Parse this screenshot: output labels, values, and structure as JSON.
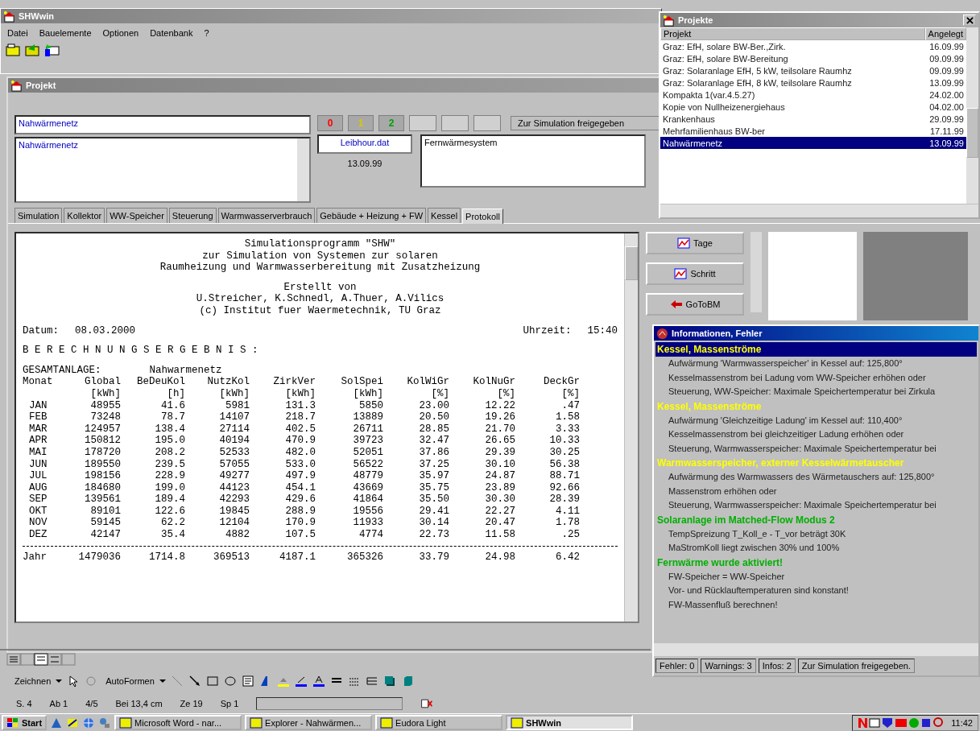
{
  "main_window": {
    "title": "SHWwin",
    "menu": [
      "Datei",
      "Bauelemente",
      "Optionen",
      "Datenbank",
      "?"
    ]
  },
  "project_window": {
    "title": "Projekt",
    "name_field": "Nahwärmenetz",
    "description_field": "Nahwärmenetz",
    "weather_file": "Leibhour.dat",
    "date": "13.09.99",
    "system_field": "Fernwärmesystem",
    "counters": [
      {
        "value": "0",
        "color": "#ff0000"
      },
      {
        "value": "1",
        "color": "#d8c800"
      },
      {
        "value": "2",
        "color": "#00a000"
      }
    ],
    "release_status": "Zur Simulation freigegeben",
    "tabs": [
      {
        "label": "Simulation",
        "selected": false
      },
      {
        "label": "Kollektor",
        "selected": false
      },
      {
        "label": "WW-Speicher",
        "selected": false
      },
      {
        "label": "Steuerung",
        "selected": false
      },
      {
        "label": "Warmwasserverbrauch",
        "selected": false
      },
      {
        "label": "Gebäude + Heizung + FW",
        "selected": false
      },
      {
        "label": "Kessel",
        "selected": false
      },
      {
        "label": "Protokoll",
        "selected": true
      }
    ],
    "report": {
      "title_lines": [
        "Simulationsprogramm \"SHW\"",
        "zur Simulation von Systemen zur solaren",
        "Raumheizung und Warmwasserbereitung mit Zusatzheizung"
      ],
      "credit_lines": [
        "Erstellt von",
        "U.Streicher, K.Schnedl, A.Thuer, A.Vilics",
        "(c) Institut fuer Waermetechnik, TU Graz"
      ],
      "date_label": "Datum:",
      "date": "08.03.2000",
      "time_label": "Uhrzeit:",
      "time": "15:40",
      "heading": "B E R E C H N U N G S E R G E B N I S :",
      "group_label": "GESAMTANLAGE:",
      "subsystem": "Nahwarmenetz",
      "columns": [
        {
          "name": "Monat"
        },
        {
          "name": "Global",
          "unit": "[kWh]"
        },
        {
          "name": "BeDeuKol",
          "unit": "[h]"
        },
        {
          "name": "NutzKol",
          "unit": "[kWh]"
        },
        {
          "name": "ZirkVer",
          "unit": "[kWh]"
        },
        {
          "name": "SolSpei",
          "unit": "[kWh]"
        },
        {
          "name": "KolWiGr",
          "unit": "[%]"
        },
        {
          "name": "KolNuGr",
          "unit": "[%]"
        },
        {
          "name": "DeckGr",
          "unit": "[%]"
        }
      ],
      "rows": [
        [
          "JAN",
          "48955",
          "41.6",
          "5981",
          "131.3",
          "5850",
          "23.00",
          "12.22",
          ".47"
        ],
        [
          "FEB",
          "73248",
          "78.7",
          "14107",
          "218.7",
          "13889",
          "20.50",
          "19.26",
          "1.58"
        ],
        [
          "MAR",
          "124957",
          "138.4",
          "27114",
          "402.5",
          "26711",
          "28.85",
          "21.70",
          "3.33"
        ],
        [
          "APR",
          "150812",
          "195.0",
          "40194",
          "470.9",
          "39723",
          "32.47",
          "26.65",
          "10.33"
        ],
        [
          "MAI",
          "178720",
          "208.2",
          "52533",
          "482.0",
          "52051",
          "37.86",
          "29.39",
          "30.25"
        ],
        [
          "JUN",
          "189550",
          "239.5",
          "57055",
          "533.0",
          "56522",
          "37.25",
          "30.10",
          "56.38"
        ],
        [
          "JUL",
          "198156",
          "228.9",
          "49277",
          "497.9",
          "48779",
          "35.97",
          "24.87",
          "88.71"
        ],
        [
          "AUG",
          "184680",
          "199.0",
          "44123",
          "454.1",
          "43669",
          "35.75",
          "23.89",
          "92.66"
        ],
        [
          "SEP",
          "139561",
          "189.4",
          "42293",
          "429.6",
          "41864",
          "35.50",
          "30.30",
          "28.39"
        ],
        [
          "OKT",
          "89101",
          "122.6",
          "19845",
          "288.9",
          "19556",
          "29.41",
          "22.27",
          "4.11"
        ],
        [
          "NOV",
          "59145",
          "62.2",
          "12104",
          "170.9",
          "11933",
          "30.14",
          "20.47",
          "1.78"
        ],
        [
          "DEZ",
          "42147",
          "35.4",
          "4882",
          "107.5",
          "4774",
          "22.73",
          "11.58",
          ".25"
        ]
      ],
      "total": [
        "Jahr",
        "1479036",
        "1714.8",
        "369513",
        "4187.1",
        "365326",
        "33.79",
        "24.98",
        "6.42"
      ]
    },
    "side_buttons": [
      "Tage",
      "Schritt",
      "GoToBM"
    ]
  },
  "projects_window": {
    "title": "Projekte",
    "columns": [
      "Projekt",
      "Angelegt"
    ],
    "rows": [
      {
        "name": "Graz: EfH, solare BW-Ber.,Zirk.",
        "date": "16.09.99",
        "selected": false
      },
      {
        "name": "Graz: EfH, solare BW-Bereitung",
        "date": "09.09.99",
        "selected": false
      },
      {
        "name": "Graz: Solaranlage EfH, 5 kW, teilsolare Raumhz",
        "date": "09.09.99",
        "selected": false
      },
      {
        "name": "Graz: Solaranlage EfH, 8 kW, teilsolare Raumhz",
        "date": "13.09.99",
        "selected": false
      },
      {
        "name": "Kompakta 1(var.4.5.27)",
        "date": "24.02.00",
        "selected": false
      },
      {
        "name": "Kopie von Nullheizenergiehaus",
        "date": "04.02.00",
        "selected": false
      },
      {
        "name": "Krankenhaus",
        "date": "29.09.99",
        "selected": false
      },
      {
        "name": "Mehrfamilienhaus BW-ber",
        "date": "17.11.99",
        "selected": false
      },
      {
        "name": "Nahwärmenetz",
        "date": "13.09.99",
        "selected": true
      }
    ]
  },
  "info_window": {
    "title": "Informationen, Fehler",
    "groups": [
      {
        "heading": "Kessel, Massenströme",
        "color": "#ffff00",
        "selected": true,
        "items": [
          "Aufwärmung 'Warmwasserspeicher' in Kessel auf: 125,800°",
          "Kesselmassenstrom bei Ladung vom WW-Speicher erhöhen oder",
          "Steuerung, WW-Speicher: Maximale Speichertemperatur bei Zirkula"
        ]
      },
      {
        "heading": "Kessel, Massenströme",
        "color": "#ffff00",
        "selected": false,
        "items": [
          "Aufwärmung 'Gleichzeitige Ladung' im Kessel auf: 110,400°",
          "Kesselmassenstrom bei gleichzeitiger Ladung erhöhen oder",
          "Steuerung, Warmwasserspeicher: Maximale Speichertemperatur bei"
        ]
      },
      {
        "heading": "Warmwasserspeicher, externer Kesselwärmetauscher",
        "color": "#ffff00",
        "selected": false,
        "items": [
          "Aufwärmung des Warmwassers des Wärmetauschers auf: 125,800°",
          "Massenstrom erhöhen oder",
          "Steuerung, Warmwasserspeicher: Maximale Speichertemperatur bei"
        ]
      },
      {
        "heading": "Solaranlage im Matched-Flow Modus 2",
        "color": "#00b000",
        "selected": false,
        "items": [
          "TempSpreizung T_Koll_e - T_vor beträgt 30K",
          "MaStromKoll liegt zwischen 30% und 100%"
        ]
      },
      {
        "heading": "Fernwärme wurde aktiviert!",
        "color": "#00b000",
        "selected": false,
        "items": [
          "FW-Speicher = WW-Speicher",
          "Vor- und Rücklauftemperaturen sind konstant!",
          "FW-Massenfluß berechnen!"
        ]
      }
    ],
    "status": [
      "Fehler: 0",
      "Warnings: 3",
      "Infos: 2",
      "Zur Simulation freigegeben."
    ]
  },
  "word": {
    "draw_menu": "Zeichnen",
    "autoshapes_menu": "AutoFormen",
    "status": [
      "S. 4",
      "Ab 1",
      "4/5",
      "Bei 13,4 cm",
      "Ze 19",
      "Sp 1"
    ]
  },
  "taskbar": {
    "start": "Start",
    "tasks": [
      {
        "label": "Microsoft Word - nar...",
        "selected": false
      },
      {
        "label": "Explorer - Nahwärmen...",
        "selected": false
      },
      {
        "label": "Eudora Light",
        "selected": false
      },
      {
        "label": "SHWwin",
        "selected": true
      }
    ],
    "clock": "11:42"
  }
}
